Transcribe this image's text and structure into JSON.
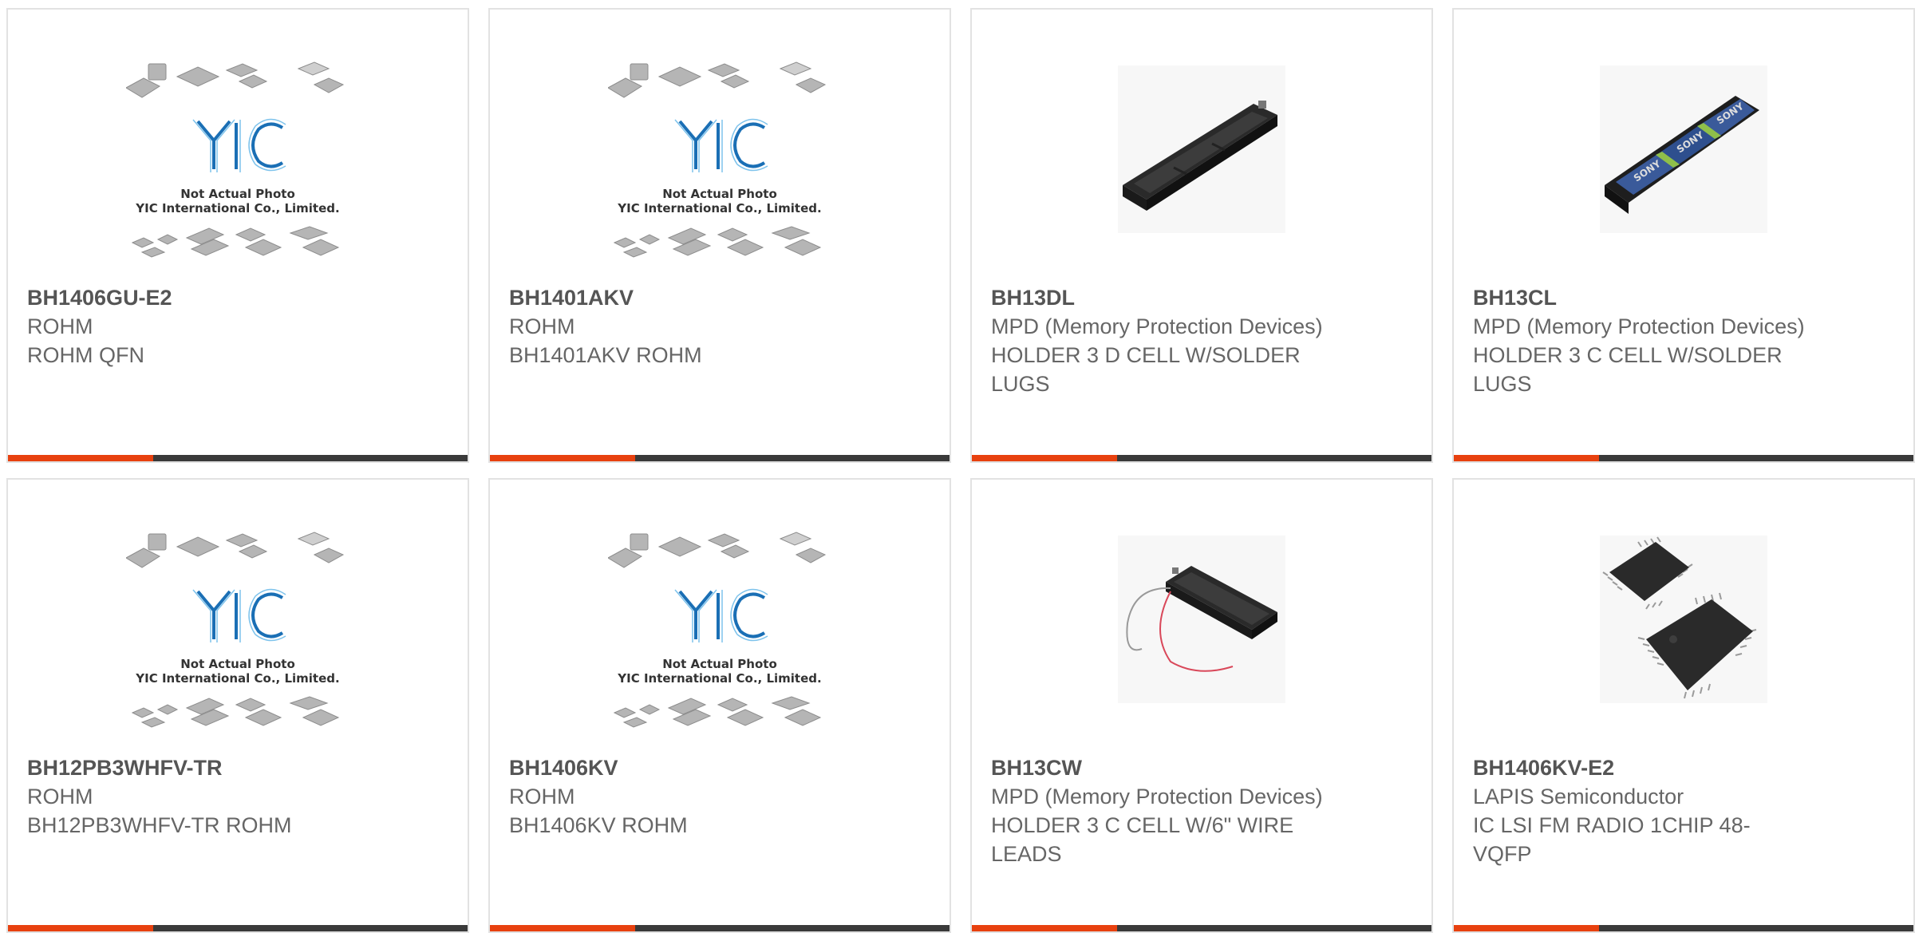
{
  "theme": {
    "accent": "#e8410f",
    "bar": "#3a3a3a",
    "logo_blue": "#1a6fb5"
  },
  "placeholder": {
    "line1": "Not Actual Photo",
    "line2": "YIC International Co., Limited.",
    "logo": "YIC"
  },
  "products": [
    {
      "part_number": "BH1406GU-E2",
      "manufacturer": "ROHM",
      "description": "ROHM QFN",
      "image": "yic-placeholder"
    },
    {
      "part_number": "BH1401AKV",
      "manufacturer": "ROHM",
      "description": "BH1401AKV ROHM",
      "image": "yic-placeholder"
    },
    {
      "part_number": "BH13DL",
      "manufacturer": "MPD (Memory Protection Devices)",
      "description": "HOLDER 3 D CELL W/SOLDER LUGS",
      "image": "battery-holder-empty"
    },
    {
      "part_number": "BH13CL",
      "manufacturer": "MPD (Memory Protection Devices)",
      "description": "HOLDER 3 C CELL W/SOLDER LUGS",
      "image": "battery-holder-loaded"
    },
    {
      "part_number": "BH12PB3WHFV-TR",
      "manufacturer": "ROHM",
      "description": "BH12PB3WHFV-TR ROHM",
      "image": "yic-placeholder"
    },
    {
      "part_number": "BH1406KV",
      "manufacturer": "ROHM",
      "description": "BH1406KV ROHM",
      "image": "yic-placeholder"
    },
    {
      "part_number": "BH13CW",
      "manufacturer": "MPD (Memory Protection Devices)",
      "description": "HOLDER 3 C CELL W/6\" WIRE LEADS",
      "image": "battery-holder-wires"
    },
    {
      "part_number": "BH1406KV-E2",
      "manufacturer": "LAPIS Semiconductor",
      "description": "IC LSI FM RADIO 1CHIP 48-VQFP",
      "image": "qfp-chips"
    }
  ]
}
